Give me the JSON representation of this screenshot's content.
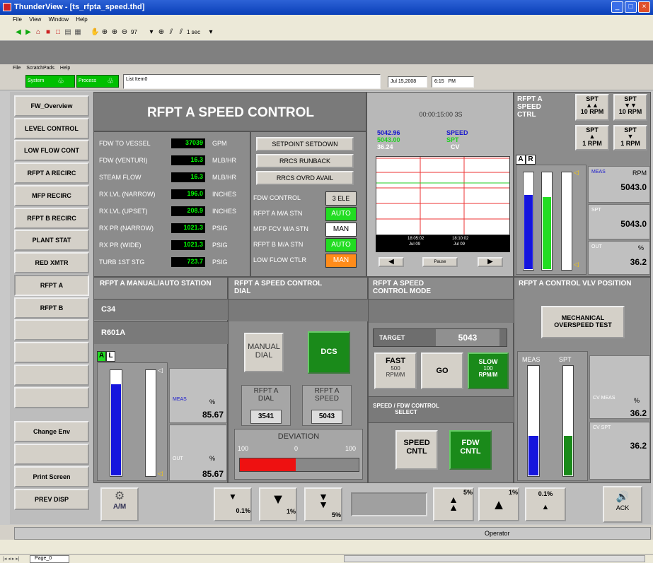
{
  "window": {
    "title": "ThunderView - [ts_rfpta_speed.thd]"
  },
  "menubar": [
    "File",
    "View",
    "Window",
    "Help"
  ],
  "toolbar": {
    "zoom_value": "97",
    "interval": "1 sec"
  },
  "inner_menu": [
    "File",
    "ScratchPads",
    "Help"
  ],
  "infobar": {
    "system_label": "System",
    "process_label": "Process",
    "list_item": "List Item0",
    "date": "Jul 15,2008",
    "time": "6:15",
    "ampm": "PM"
  },
  "nav": [
    "FW_Overview",
    "LEVEL CONTROL",
    "LOW FLOW CONT",
    "RFPT A RECIRC",
    "MFP RECIRC",
    "RFPT B RECIRC",
    "PLANT STAT",
    "RED XMTR",
    "RFPT A",
    "RFPT B",
    "",
    "",
    "",
    "",
    "Change Env",
    "",
    "Print Screen",
    "PREV DISP"
  ],
  "header": {
    "title": "RFPT A SPEED CONTROL"
  },
  "readings": [
    {
      "label": "FDW TO VESSEL",
      "value": "37039",
      "unit": "GPM"
    },
    {
      "label": "FDW (VENTURI)",
      "value": "16.3",
      "unit": "MLB/HR"
    },
    {
      "label": "STEAM FLOW",
      "value": "16.3",
      "unit": "MLB/HR"
    },
    {
      "label": "RX LVL (NARROW)",
      "value": "196.0",
      "unit": "INCHES"
    },
    {
      "label": "RX LVL (UPSET)",
      "value": "208.9",
      "unit": "INCHES"
    },
    {
      "label": "RX PR (NARROW)",
      "value": "1021.3",
      "unit": "PSIG"
    },
    {
      "label": "RX PR (WIDE)",
      "value": "1021.3",
      "unit": "PSIG"
    },
    {
      "label": "TURB 1ST STG",
      "value": "723.7",
      "unit": "PSIG"
    }
  ],
  "alarms": [
    "SETPOINT SETDOWN",
    "RRCS RUNBACK",
    "RRCS OVRD AVAIL"
  ],
  "stations": [
    {
      "label": "FDW CONTROL",
      "state": "3 ELE",
      "color": "#d4d0c8"
    },
    {
      "label": "RFPT A M/A STN",
      "state": "AUTO",
      "color": "#22dd22"
    },
    {
      "label": "MFP FCV M/A STN",
      "state": "MAN",
      "color": "#ffffff"
    },
    {
      "label": "RFPT B M/A STN",
      "state": "AUTO",
      "color": "#22dd22"
    },
    {
      "label": "LOW FLOW CTLR",
      "state": "MAN",
      "color": "#ff8c1a"
    }
  ],
  "trend": {
    "timespan": "00:00:15:00 3S",
    "v1": "5042.96",
    "v2": "5043.00",
    "v3": "36.24",
    "s1": "SPEED",
    "s2": "SPT",
    "s3": "CV",
    "t1": "18:05:02",
    "d1": "Jul 09",
    "t2": "18:10:02",
    "d2": "Jul 09",
    "pause": "Pause"
  },
  "rfpt_ctrl": {
    "title": "RFPT A SPEED CTRL",
    "btn1": "10 RPM",
    "btn2": "10 RPM",
    "btn3": "1 RPM",
    "btn4": "1 RPM",
    "spt": "SPT",
    "a": "A",
    "r": "R",
    "meas": "MEAS",
    "rpm": "RPM",
    "meas_val": "5043.0",
    "spt_lbl": "SPT",
    "spt_val": "5043.0",
    "out": "OUT",
    "pct": "%",
    "out_val": "36.2",
    "bar_meas": 0.76,
    "bar_spt": 0.74,
    "bar_out": 0.36
  },
  "manauto": {
    "title": "RFPT A MANUAL/AUTO STATION",
    "r1": "C34",
    "r2": "R601A",
    "a": "A",
    "l": "L",
    "meas": "MEAS",
    "pct": "%",
    "meas_val": "85.67",
    "out": "OUT",
    "out_val": "85.67",
    "bar_meas": 0.86,
    "bar_out": 0.86
  },
  "dial": {
    "title": "RFPT A SPEED CONTROL DIAL",
    "manual": "MANUAL DIAL",
    "dcs": "DCS",
    "dial_lbl": "RFPT A DIAL",
    "dial_val": "3541",
    "speed_lbl": "RFPT A SPEED",
    "speed_val": "5043",
    "deviation": "DEVIATION",
    "dmin": "100",
    "dmid": "0",
    "dmax": "100",
    "dev_frac": 0.47
  },
  "mode": {
    "title": "RFPT A SPEED CONTROL MODE",
    "target_lbl": "TARGET",
    "target_val": "5043",
    "fast": "FAST",
    "fast_rate": "500",
    "fast_unit": "RPM/M",
    "go": "GO",
    "slow": "SLOW",
    "slow_rate": "100",
    "slow_unit": "RPM/M",
    "sel_title": "SPEED / FDW CONTROL SELECT",
    "speed": "SPEED CNTL",
    "fdw": "FDW CNTL"
  },
  "vlv": {
    "title": "RFPT A CONTROL VLV POSITION",
    "mech": "MECHANICAL OVERSPEED TEST",
    "meas": "MEAS",
    "spt": "SPT",
    "cvm": "CV MEAS",
    "pct": "%",
    "cvm_val": "36.2",
    "cvs": "CV SPT",
    "cvs_val": "36.2",
    "bar_meas": 0.36,
    "bar_spt": 0.36
  },
  "bottom": {
    "am": "A/M",
    "d1": "0.1%",
    "d2": "1%",
    "d3": "5%",
    "u1": "5%",
    "u2": "1%",
    "u3": "0.1%",
    "ack": "ACK"
  },
  "status": {
    "operator": "Operator"
  },
  "tabs": {
    "page": "Page_0"
  }
}
